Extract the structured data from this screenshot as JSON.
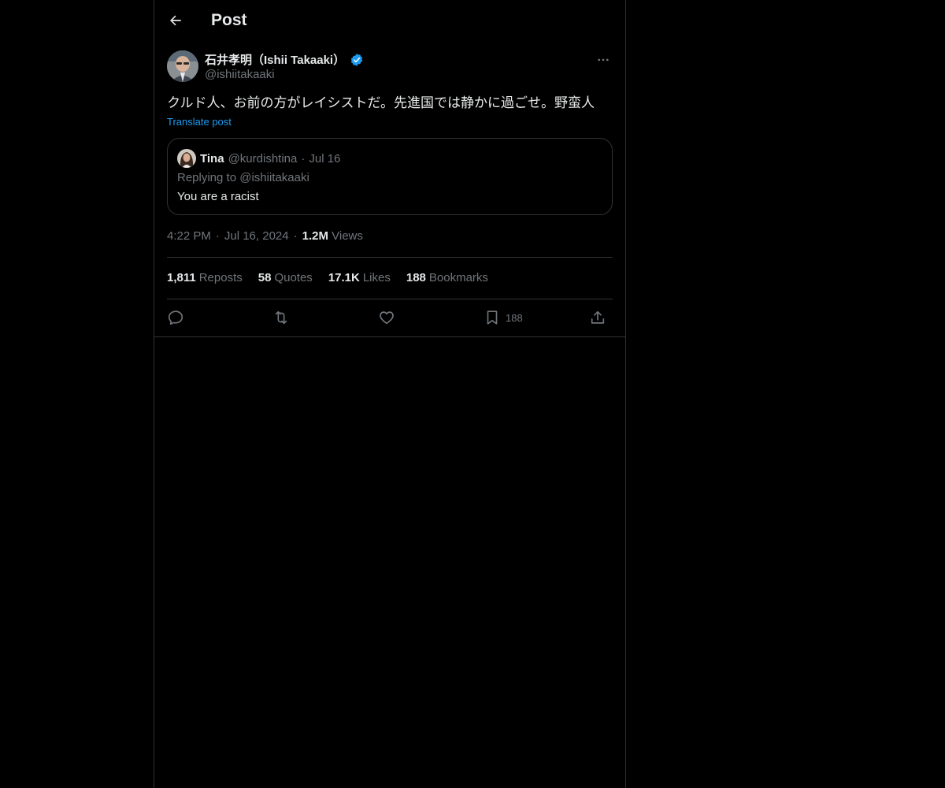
{
  "header": {
    "title": "Post"
  },
  "author": {
    "name": "石井孝明（Ishii Takaaki）",
    "handle": "@ishiitakaaki",
    "verified": true
  },
  "post": {
    "text": "クルド人、お前の方がレイシストだ。先進国では静かに過ごせ。野蛮人",
    "translate_label": "Translate post"
  },
  "quote": {
    "name": "Tina",
    "handle": "@kurdishtina",
    "separator": "·",
    "date": "Jul 16",
    "replying_to": "Replying to @ishiitakaaki",
    "text": "You are a racist"
  },
  "meta": {
    "time": "4:22 PM",
    "separator": "·",
    "date": "Jul 16, 2024",
    "views_count": "1.2M",
    "views_label": "Views"
  },
  "stats": {
    "reposts_count": "1,811",
    "reposts_label": "Reposts",
    "quotes_count": "58",
    "quotes_label": "Quotes",
    "likes_count": "17.1K",
    "likes_label": "Likes",
    "bookmarks_count": "188",
    "bookmarks_label": "Bookmarks"
  },
  "actions": {
    "bookmark_count": "188",
    "icons": [
      "reply-icon",
      "repost-icon",
      "like-icon",
      "bookmark-icon",
      "share-icon"
    ]
  },
  "colors": {
    "background": "#000000",
    "text_primary": "#e7e9ea",
    "text_secondary": "#71767b",
    "accent": "#1d9bf0",
    "border": "#2f3336"
  }
}
